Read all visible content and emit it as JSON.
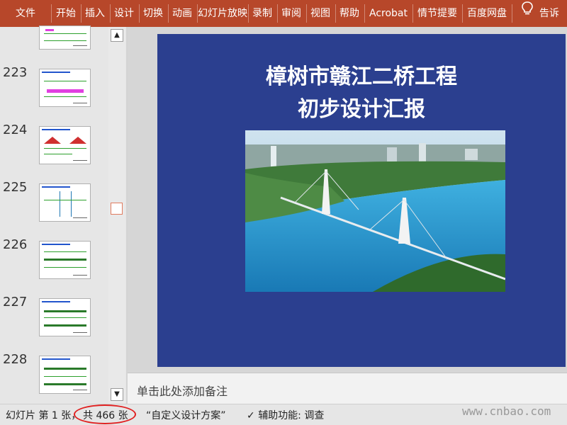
{
  "ribbon": {
    "tabs": [
      {
        "label": "文件"
      },
      {
        "label": "开始"
      },
      {
        "label": "插入"
      },
      {
        "label": "设计"
      },
      {
        "label": "切换"
      },
      {
        "label": "动画"
      },
      {
        "label": "幻灯片放映"
      },
      {
        "label": "录制"
      },
      {
        "label": "审阅"
      },
      {
        "label": "视图"
      },
      {
        "label": "帮助"
      },
      {
        "label": "Acrobat"
      },
      {
        "label": "情节提要"
      },
      {
        "label": "百度网盘"
      }
    ],
    "tell_me": "告诉我"
  },
  "thumbnails": {
    "numbers": [
      "223",
      "224",
      "225",
      "226",
      "227",
      "228"
    ]
  },
  "slide": {
    "title_line1": "樟树市赣江二桥工程",
    "title_line2": "初步设计汇报",
    "background_color": "#2b3f8f"
  },
  "notes": {
    "placeholder": "单击此处添加备注"
  },
  "status": {
    "slide_label": "幻灯片 第 1 张，",
    "total_label": "共 466 张",
    "theme": "“自定义设计方案”",
    "accessibility": "辅助功能: 调查"
  },
  "watermark": "www.cnbao.com"
}
